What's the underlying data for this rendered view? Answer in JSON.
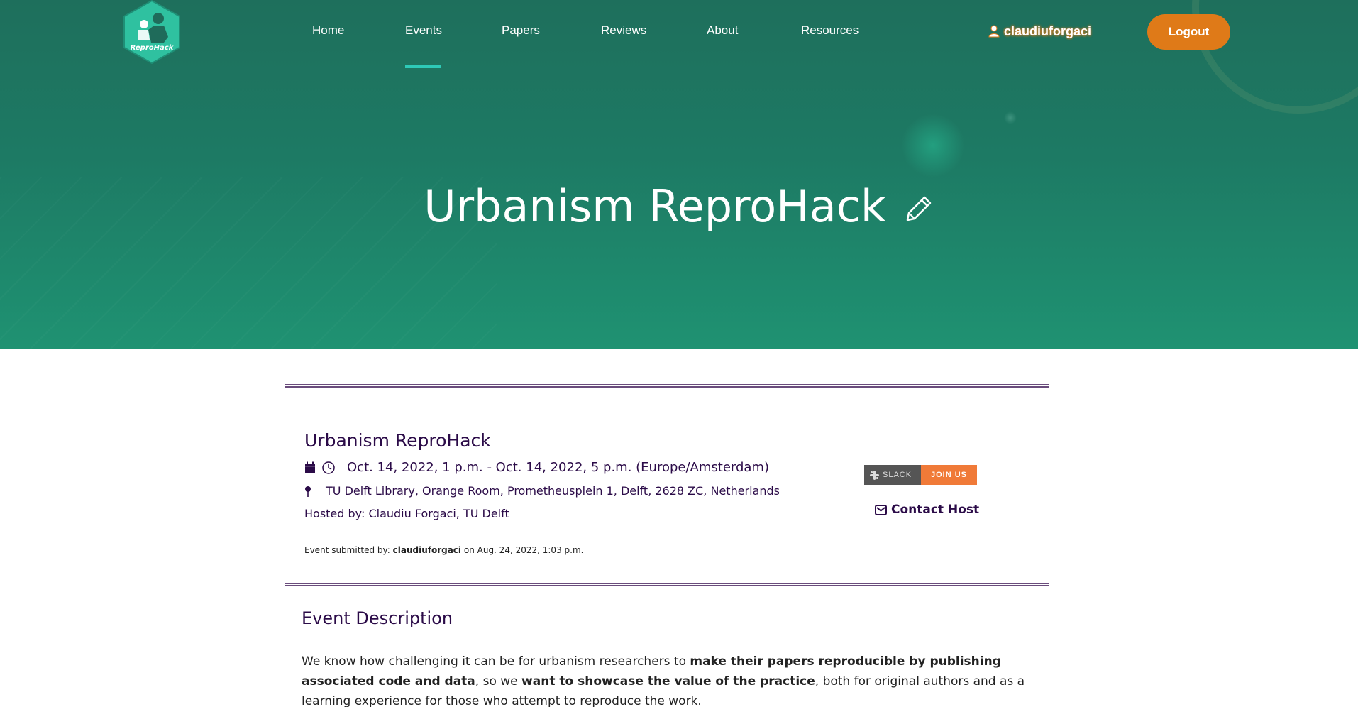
{
  "nav": {
    "logo_text": "ReproHack",
    "items": [
      {
        "label": "Home"
      },
      {
        "label": "Events"
      },
      {
        "label": "Papers"
      },
      {
        "label": "Reviews"
      },
      {
        "label": "About"
      },
      {
        "label": "Resources"
      }
    ],
    "active_item": "Events",
    "user": "claudiuforgaci",
    "logout_label": "Logout"
  },
  "hero": {
    "title": "Urbanism ReproHack",
    "edit_icon": "pencil-icon"
  },
  "event": {
    "title": "Urbanism ReproHack",
    "datetime": "Oct. 14, 2022, 1 p.m. - Oct. 14, 2022, 5 p.m. (Europe/Amsterdam)",
    "location": "TU Delft Library, Orange Room, Prometheusplein 1, Delft, 2628 ZC, Netherlands",
    "hosted_by": "Hosted by: Claudiu Forgaci, TU Delft",
    "submitted_prefix": "Event submitted by: ",
    "submitted_user": "claudiuforgaci",
    "submitted_suffix": " on Aug. 24, 2022, 1:03 p.m."
  },
  "sidebar": {
    "slack_label": "SLACK",
    "join_label": "JOIN US",
    "contact_label": "Contact Host"
  },
  "description": {
    "heading": "Event Description",
    "p1": "We know how challenging it can be for urbanism researchers to ",
    "p1_bold": "make their papers reproducible by publishing associated code and data",
    "p2": ", so we ",
    "p2_bold": "want to showcase the value of the practice",
    "p3": ", both for original authors and as a learning experience for those who attempt to reproduce the work."
  },
  "colors": {
    "hero_top": "#1e6f5c",
    "hero_bottom": "#1f9272",
    "accent_orange": "#df7a18",
    "nav_underline": "#2ec9b7",
    "text_purple": "#2b0b48"
  }
}
